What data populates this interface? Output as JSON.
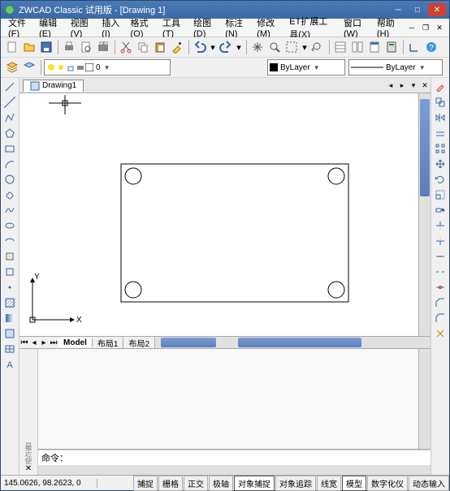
{
  "title": "ZWCAD Classic 试用版 - [Drawing 1]",
  "menu": {
    "file": "文件(F)",
    "edit": "编辑(E)",
    "view": "视图(V)",
    "insert": "插入(I)",
    "format": "格式(O)",
    "tools": "工具(T)",
    "draw": "绘图(D)",
    "dim": "标注(N)",
    "modify": "修改(M)",
    "et": "ET扩展工具(X)",
    "window": "窗口(W)",
    "help": "帮助(H)"
  },
  "doc_tab": "Drawing1",
  "layer": {
    "value": "0"
  },
  "props": {
    "color": "ByLayer",
    "line": "ByLayer"
  },
  "layout_tabs": {
    "model": "Model",
    "l1": "布局1",
    "l2": "布局2"
  },
  "cmd_prompt": "命令：",
  "status": {
    "coords": "145.0626, 98.2623, 0",
    "snap": "捕捉",
    "grid": "栅格",
    "ortho": "正交",
    "polar": "极轴",
    "osnap": "对象捕捉",
    "otrack": "对象追踪",
    "lwt": "线宽",
    "model": "模型",
    "digitizer": "数字化仪",
    "dyn": "动态输入"
  },
  "axis": {
    "x": "X",
    "y": "Y"
  }
}
